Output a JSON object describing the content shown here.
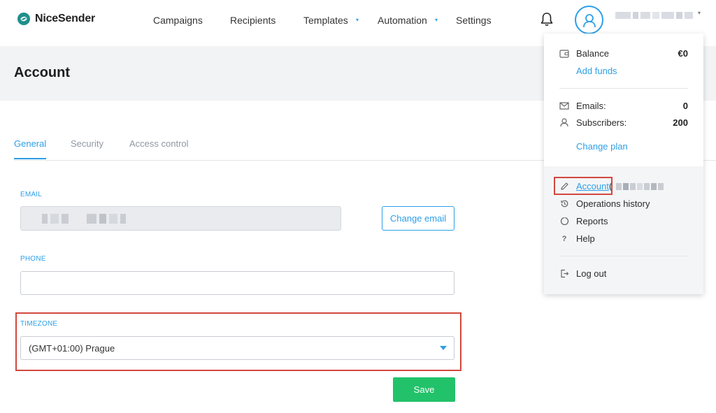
{
  "app": {
    "brand": "NiceSender"
  },
  "nav": {
    "items": [
      {
        "label": "Campaigns"
      },
      {
        "label": "Recipients"
      },
      {
        "label": "Templates",
        "caret": "▾"
      },
      {
        "label": "Automation",
        "caret": "▾"
      },
      {
        "label": "Settings"
      }
    ]
  },
  "header": {
    "title": "Account"
  },
  "tabs": [
    {
      "label": "General",
      "active": true
    },
    {
      "label": "Security",
      "active": false
    },
    {
      "label": "Access control",
      "active": false
    }
  ],
  "form": {
    "email": {
      "label": "EMAIL",
      "button": "Change email"
    },
    "phone": {
      "label": "PHONE",
      "value": "",
      "placeholder": ""
    },
    "timezone": {
      "label": "TIMEZONE",
      "value": "(GMT+01:00) Prague"
    },
    "save": "Save"
  },
  "dropdown": {
    "balance": {
      "label": "Balance",
      "value": "€0",
      "action": "Add funds"
    },
    "emails": {
      "label": "Emails:",
      "value": "0"
    },
    "subscribers": {
      "label": "Subscribers:",
      "value": "200"
    },
    "change_plan": "Change plan",
    "menu": {
      "account": "Account",
      "account_suffix": "(",
      "operations": "Operations history",
      "reports": "Reports",
      "help": "Help",
      "logout": "Log out"
    }
  },
  "colors": {
    "accent": "#2d9fe8",
    "save": "#22c26a",
    "highlight": "#d2483e",
    "band": "#f2f3f5"
  }
}
